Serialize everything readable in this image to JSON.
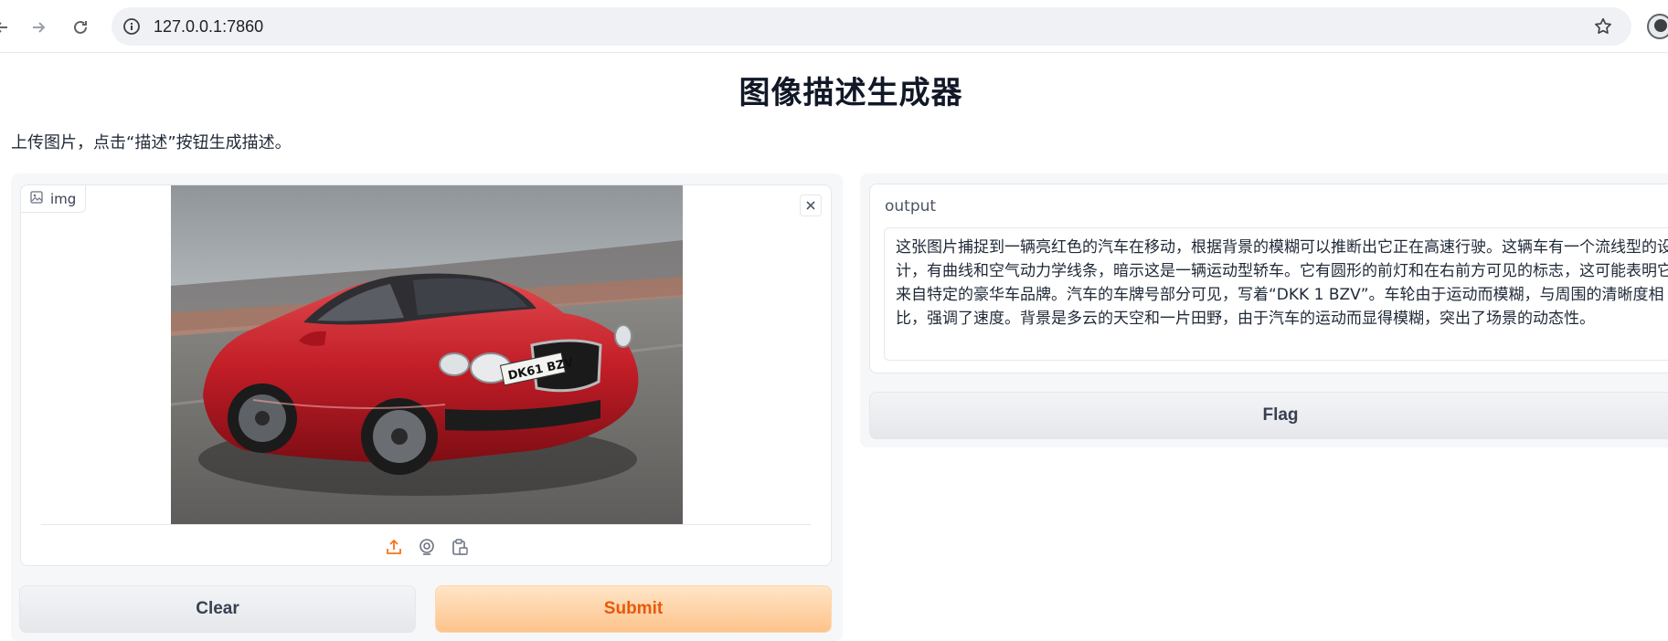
{
  "browser": {
    "url": "127.0.0.1:7860",
    "back_icon": "arrow-left-icon",
    "forward_icon": "arrow-right-icon",
    "reload_icon": "reload-icon"
  },
  "page": {
    "title": "图像描述生成器",
    "description": "上传图片，点击“描述”按钮生成描述。"
  },
  "image_input": {
    "label": "img",
    "source_icons": [
      "upload-icon",
      "webcam-icon",
      "clipboard-icon"
    ]
  },
  "buttons": {
    "clear": "Clear",
    "submit": "Submit",
    "flag": "Flag"
  },
  "output": {
    "label": "output",
    "text": "这张图片捕捉到一辆亮红色的汽车在移动，根据背景的模糊可以推断出它正在高速行驶。这辆车有一个流线型的设计，有曲线和空气动力学线条，暗示这是一辆运动型轿车。它有圆形的前灯和在右前方可见的标志，这可能表明它来自特定的豪华车品牌。汽车的车牌号部分可见，写着“DKK 1 BZV”。车轮由于运动而模糊，与周围的清晰度相比，强调了速度。背景是多云的天空和一片田野，由于汽车的运动而显得模糊，突出了场景的动态性。"
  },
  "photo": {
    "plate_text": "DK61 BZV"
  },
  "colors": {
    "submit_text": "#ea580c",
    "submit_bg": "#fdc38b",
    "upload_icon": "#f97316"
  }
}
